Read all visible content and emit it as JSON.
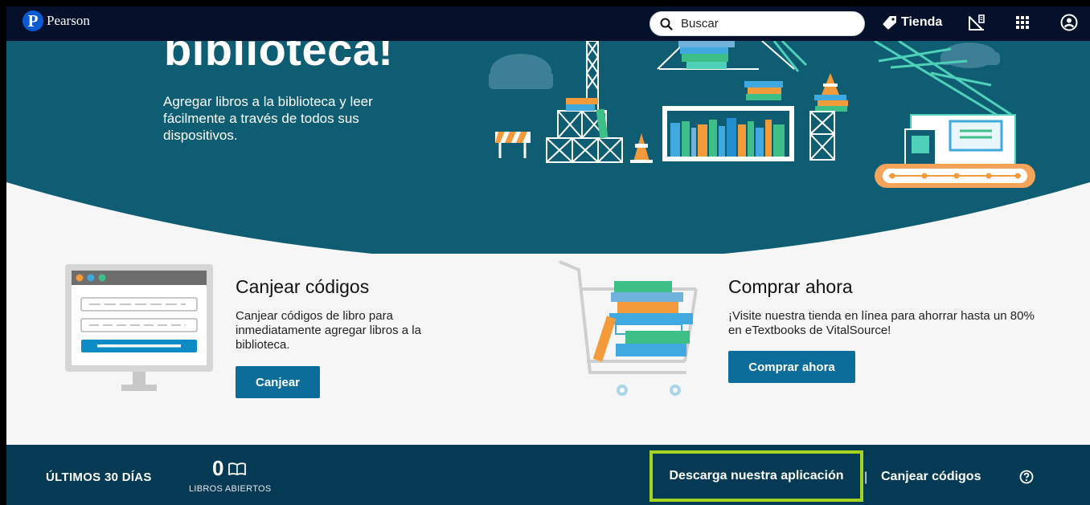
{
  "header": {
    "brand": "Pearson",
    "search_placeholder": "Buscar",
    "store_label": "Tienda",
    "icons": [
      "search-icon",
      "tag-icon",
      "announcement-icon",
      "apps-grid-icon",
      "account-icon"
    ]
  },
  "hero": {
    "title": "biblioteca!",
    "description": "Agregar libros a la biblioteca y leer fácilmente a través de todos sus dispositivos."
  },
  "redeem_card": {
    "title": "Canjear códigos",
    "description": "Canjear códigos de libro para inmediatamente agregar libros a la biblioteca.",
    "button_label": "Canjear"
  },
  "buy_card": {
    "title": "Comprar ahora",
    "description": "¡Visite nuestra tienda en línea para ahorrar hasta un 80% en eTextbooks de VitalSource!",
    "button_label": "Comprar ahora"
  },
  "footer": {
    "period_label": "ÚLTIMOS 30 DÍAS",
    "books_opened_count": "0",
    "books_opened_label": "LIBROS ABIERTOS",
    "download_app_label": "Descarga nuestra aplicación",
    "separator": "|",
    "redeem_codes_label": "Canjear códigos"
  },
  "colors": {
    "nav_bg": "#05112a",
    "hero_bg": "#0f5d73",
    "button_bg": "#0d6d9a",
    "footer_bg": "#053a55",
    "highlight": "#a4d41e"
  }
}
